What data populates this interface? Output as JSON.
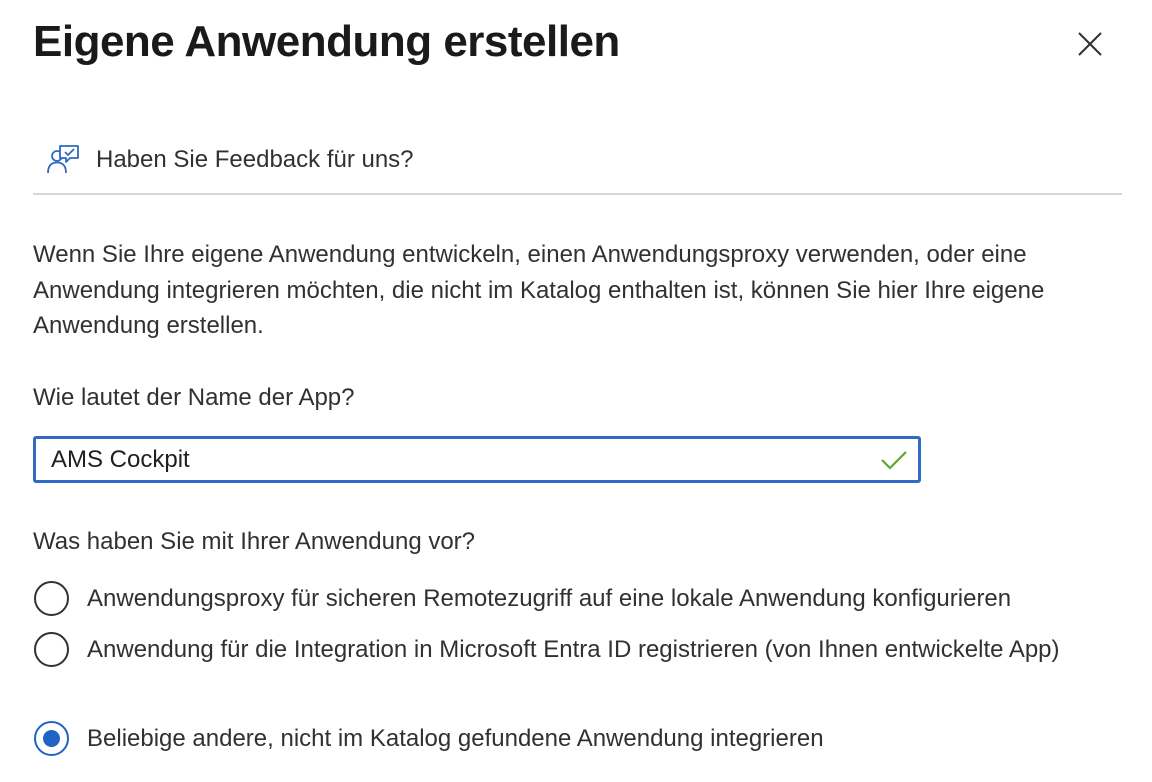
{
  "header": {
    "title": "Eigene Anwendung erstellen"
  },
  "feedback": {
    "label": "Haben Sie Feedback für uns?",
    "icon": "feedback-person-icon"
  },
  "description": "Wenn Sie Ihre eigene Anwendung entwickeln, einen Anwendungsproxy verwenden, oder eine Anwendung integrieren möchten, die nicht im Katalog enthalten ist, können Sie hier Ihre eigene Anwendung erstellen.",
  "form": {
    "name_label": "Wie lautet der Name der App?",
    "name_value": "AMS Cockpit",
    "name_valid": true,
    "purpose_label": "Was haben Sie mit Ihrer Anwendung vor?",
    "options": [
      {
        "label": "Anwendungsproxy für sicheren Remotezugriff auf eine lokale Anwendung konfigurieren",
        "selected": false
      },
      {
        "label": "Anwendung für die Integration in Microsoft Entra ID registrieren (von Ihnen entwickelte App)",
        "selected": false
      },
      {
        "label": "Beliebige andere, nicht im Katalog gefundene Anwendung integrieren",
        "selected": true
      }
    ]
  },
  "colors": {
    "accent": "#1f63c4",
    "input_border": "#2f6ac4",
    "valid_check": "#5ea62b",
    "text": "#323130",
    "divider": "#d6d6d6"
  }
}
